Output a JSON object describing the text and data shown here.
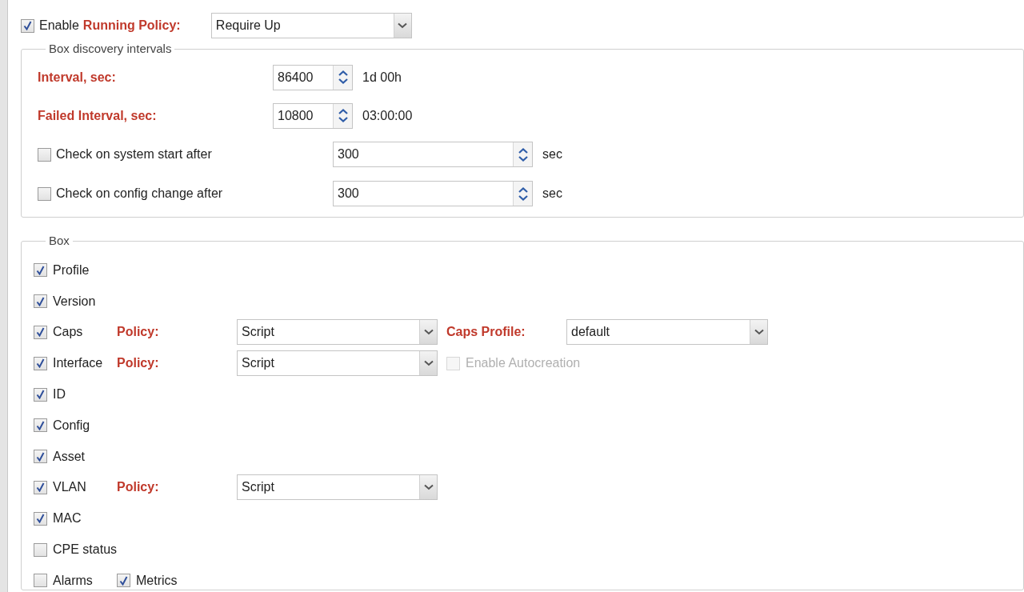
{
  "running_policy": {
    "enabled": true,
    "prefix": "Enable",
    "label": "Running Policy:",
    "value": "Require Up"
  },
  "intervals": {
    "title": "Box discovery intervals",
    "rows": [
      {
        "kind": "spinner",
        "label": "Interval, sec:",
        "value": "86400",
        "hint": "1d 00h"
      },
      {
        "kind": "spinner",
        "label": "Failed Interval, sec:",
        "value": "10800",
        "hint": "03:00:00"
      },
      {
        "kind": "check",
        "label": "Check on system start after",
        "checked": false,
        "value": "300",
        "unit": "sec"
      },
      {
        "kind": "check",
        "label": "Check on config change after",
        "checked": false,
        "value": "300",
        "unit": "sec"
      }
    ]
  },
  "box": {
    "title": "Box",
    "rows": [
      {
        "checks": [
          {
            "label": "Profile",
            "checked": true
          }
        ]
      },
      {
        "checks": [
          {
            "label": "Version",
            "checked": true
          }
        ]
      },
      {
        "checks": [
          {
            "label": "Caps",
            "checked": true
          }
        ],
        "policy": {
          "label": "Policy:",
          "value": "Script"
        },
        "extra": {
          "kind": "dropdown",
          "label": "Caps Profile:",
          "value": "default"
        }
      },
      {
        "checks": [
          {
            "label": "Interface",
            "checked": true
          }
        ],
        "policy": {
          "label": "Policy:",
          "value": "Script"
        },
        "extra": {
          "kind": "checkbox",
          "label": "Enable Autocreation",
          "checked": false,
          "disabled": true
        }
      },
      {
        "checks": [
          {
            "label": "ID",
            "checked": true
          }
        ]
      },
      {
        "checks": [
          {
            "label": "Config",
            "checked": true
          }
        ]
      },
      {
        "checks": [
          {
            "label": "Asset",
            "checked": true
          }
        ]
      },
      {
        "checks": [
          {
            "label": "VLAN",
            "checked": true
          }
        ],
        "policy": {
          "label": "Policy:",
          "value": "Script"
        }
      },
      {
        "checks": [
          {
            "label": "MAC",
            "checked": true
          }
        ]
      },
      {
        "checks": [
          {
            "label": "CPE status",
            "checked": false
          }
        ]
      },
      {
        "checks": [
          {
            "label": "Alarms",
            "checked": false
          },
          {
            "label": "Metrics",
            "checked": true
          }
        ]
      }
    ]
  }
}
